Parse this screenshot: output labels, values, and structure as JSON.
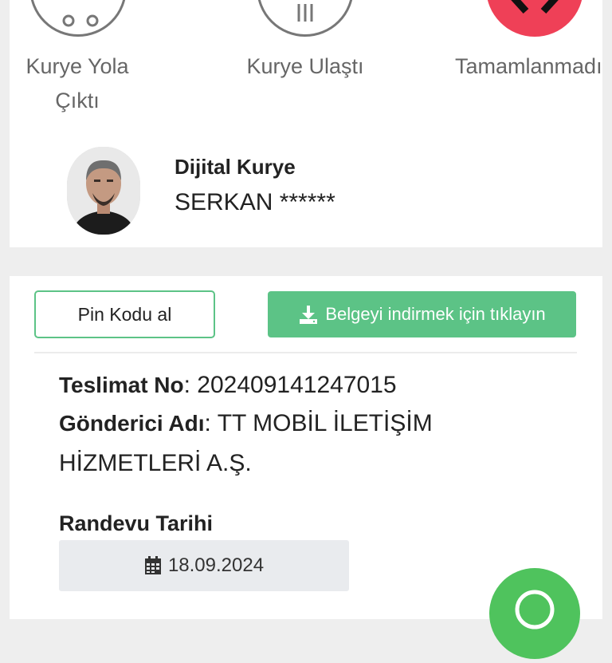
{
  "status_steps": [
    {
      "label_line1": "Kurye Yola",
      "label_line2": "Çıktı",
      "icon": "courier-on-way-icon"
    },
    {
      "label_line1": "Kurye Ulaştı",
      "icon": "courier-arrived-icon"
    },
    {
      "label_line1": "Tamamlanmadı",
      "icon": "close-icon",
      "color": "#ef4057"
    }
  ],
  "courier": {
    "title": "Dijital Kurye",
    "name": "SERKAN ******",
    "photo_icon": "avatar"
  },
  "actions": {
    "pin_label": "Pin Kodu al",
    "download_label": "Belgeyi indirmek için tıklayın",
    "download_icon": "download-icon"
  },
  "delivery": {
    "tracking_label": "Teslimat No",
    "tracking_value": "202409141247015",
    "sender_label": "Gönderici Adı",
    "sender_value_line1": "TT MOBİL İLETİŞİM",
    "sender_value_line2": "HİZMETLERİ A.Ş.",
    "appointment_label": "Randevu Tarihi",
    "appointment_date": "18.09.2024",
    "calendar_icon": "calendar-icon"
  },
  "whatsapp": {
    "icon": "whatsapp-icon",
    "color": "#4fc35d"
  },
  "colors": {
    "accent": "#5cc386",
    "danger": "#ef4057"
  }
}
